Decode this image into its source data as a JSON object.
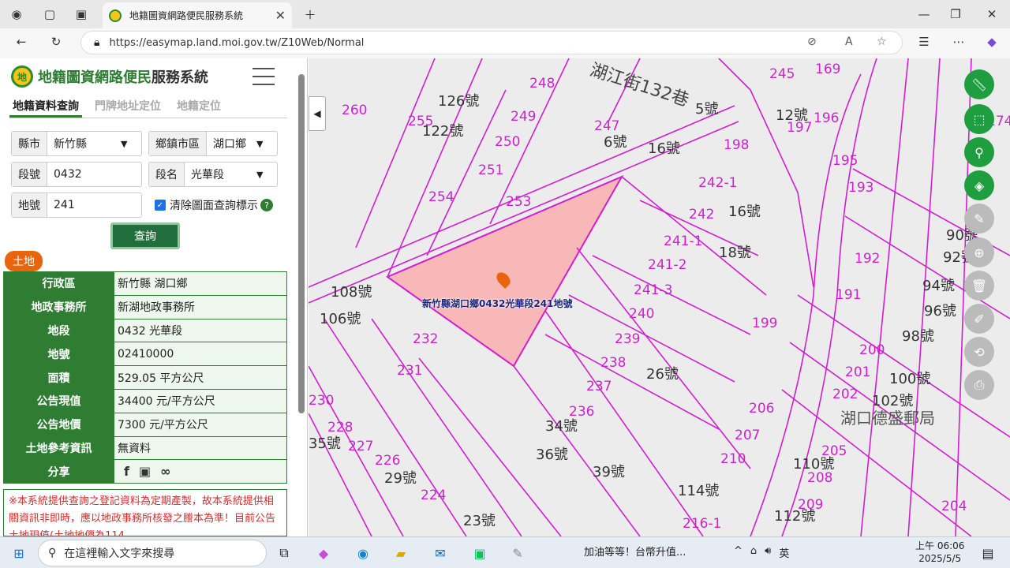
{
  "browser": {
    "tab_title": "地籍圖資網路便民服務系統",
    "url": "https://easymap.land.moi.gov.tw/Z10Web/Normal"
  },
  "site": {
    "title_green": "地籍圖資網路便民",
    "title_rest": "服務系統",
    "logo_text": "地"
  },
  "query_tabs": [
    "地籍資料查詢",
    "門牌地址定位",
    "地籍定位"
  ],
  "form": {
    "county_label": "縣市",
    "county_value": "新竹縣",
    "town_label": "鄉鎮市區",
    "town_value": "湖口鄉",
    "section_no_label": "段號",
    "section_no_value": "0432",
    "section_name_label": "段名",
    "section_name_value": "光華段",
    "lot_label": "地號",
    "lot_value": "241",
    "clear_checkbox_label": "清除圖面查詢標示",
    "query_button": "查詢"
  },
  "land_badge": "土地",
  "info_rows": [
    {
      "k": "行政區",
      "v": "新竹縣 湖口鄉"
    },
    {
      "k": "地政事務所",
      "v": "新湖地政事務所"
    },
    {
      "k": "地段",
      "v": "0432 光華段"
    },
    {
      "k": "地號",
      "v": "02410000"
    },
    {
      "k": "面積",
      "v": "529.05 平方公尺"
    },
    {
      "k": "公告現值",
      "v": "34400 元/平方公尺"
    },
    {
      "k": "公告地價",
      "v": "7300 元/平方公尺"
    },
    {
      "k": "土地參考資訊",
      "v": "無資料"
    }
  ],
  "share_label": "分享",
  "notice": "※本系統提供查詢之登記資料為定期產製，故本系統提供相關資訊非即時，應以地政事務所核發之謄本為準！目前公告土地現值(土地地價為114",
  "map": {
    "pin_label": "新竹縣湖口鄉0432光華段241地號",
    "street_label": "湖江街132巷",
    "post_office": "湖口德盛郵局"
  },
  "taskbar": {
    "search_placeholder": "在這裡輸入文字來搜尋",
    "news": "加油等等！台幣升值...",
    "ime": "英",
    "time": "上午 06:06",
    "date": "2025/5/5"
  }
}
